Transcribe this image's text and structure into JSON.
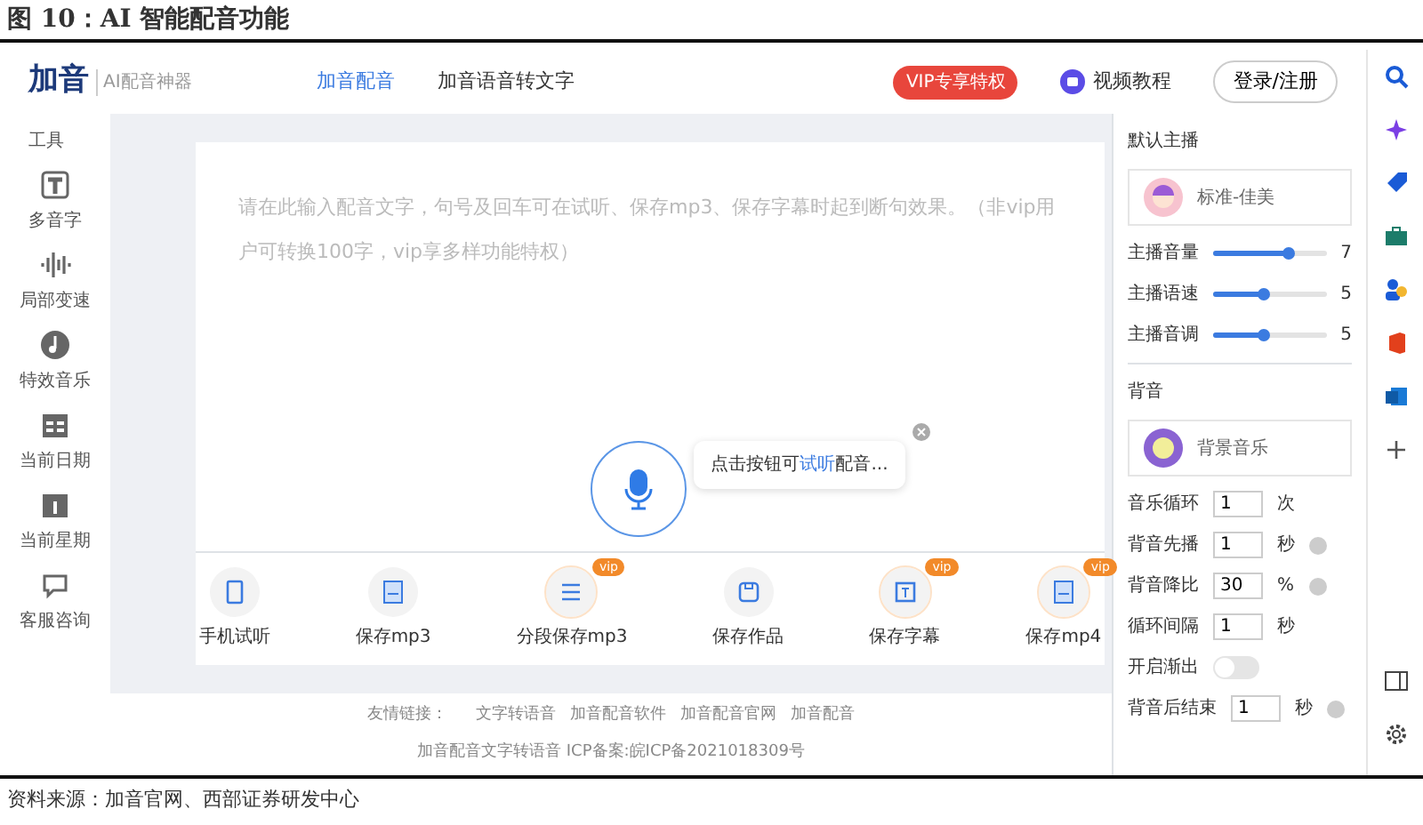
{
  "figure_title": "图 10：AI 智能配音功能",
  "header": {
    "logo": "加音",
    "tagline": "AI配音神器",
    "tabs": [
      {
        "label": "加音配音",
        "selected": true
      },
      {
        "label": "加音语音转文字",
        "selected": false
      }
    ],
    "vip_badge": "VIP专享特权",
    "tutorial": "视频教程",
    "login": "登录/注册"
  },
  "sidebar": {
    "heading": "工具",
    "items": [
      {
        "label": "多音字",
        "kind": "polyphone"
      },
      {
        "label": "局部变速",
        "kind": "speed"
      },
      {
        "label": "特效音乐",
        "kind": "music"
      },
      {
        "label": "当前日期",
        "kind": "date"
      },
      {
        "label": "当前星期",
        "kind": "week"
      },
      {
        "label": "客服咨询",
        "kind": "service"
      }
    ]
  },
  "editor": {
    "placeholder": "请在此输入配音文字，句号及回车可在试听、保存mp3、保存字幕时起到断句效果。（非vip用户可转换100字，vip享多样功能特权）",
    "tooltip": {
      "text_before": "点击按钮可",
      "highlight": "试听",
      "text_after": "配音..."
    },
    "actions": [
      {
        "label": "手机试听",
        "kind": "phone",
        "vip": false
      },
      {
        "label": "保存mp3",
        "kind": "mp3",
        "vip": false
      },
      {
        "label": "分段保存mp3",
        "kind": "list",
        "vip": true,
        "vip_label": "vip"
      },
      {
        "label": "保存作品",
        "kind": "save",
        "vip": false
      },
      {
        "label": "保存字幕",
        "kind": "subtitle",
        "vip": true,
        "vip_label": "vip"
      },
      {
        "label": "保存mp4",
        "kind": "mp4",
        "vip": true,
        "vip_label": "vip"
      }
    ]
  },
  "footer": {
    "links_label": "友情链接：",
    "links": [
      "文字转语音",
      "加音配音软件",
      "加音配音官网",
      "加音配音"
    ],
    "icp": "加音配音文字转语音 ICP备案:皖ICP备2021018309号"
  },
  "settings": {
    "voice_heading": "默认主播",
    "voice": "标准-佳美",
    "sliders": [
      {
        "label": "主播音量",
        "level": 0.68,
        "reading": "7"
      },
      {
        "label": "主播语速",
        "level": 0.46,
        "reading": "5"
      },
      {
        "label": "主播音调",
        "level": 0.46,
        "reading": "5"
      }
    ],
    "bg_heading": "背音",
    "bg_music": "背景音乐",
    "fields": [
      {
        "label": "音乐循环",
        "kind": "number",
        "value": "1",
        "unit": "次",
        "help": false
      },
      {
        "label": "背音先播",
        "kind": "number",
        "value": "1",
        "unit": "秒",
        "help": true
      },
      {
        "label": "背音降比",
        "kind": "number",
        "value": "30",
        "unit": "%",
        "help": true
      },
      {
        "label": "循环间隔",
        "kind": "number",
        "value": "1",
        "unit": "秒",
        "help": false
      },
      {
        "label": "开启渐出",
        "kind": "toggle",
        "on": false
      },
      {
        "label": "背音后结束",
        "kind": "number",
        "value": "1",
        "unit": "秒",
        "help": true
      }
    ]
  },
  "source": "资料来源：加音官网、西部证券研发中心"
}
